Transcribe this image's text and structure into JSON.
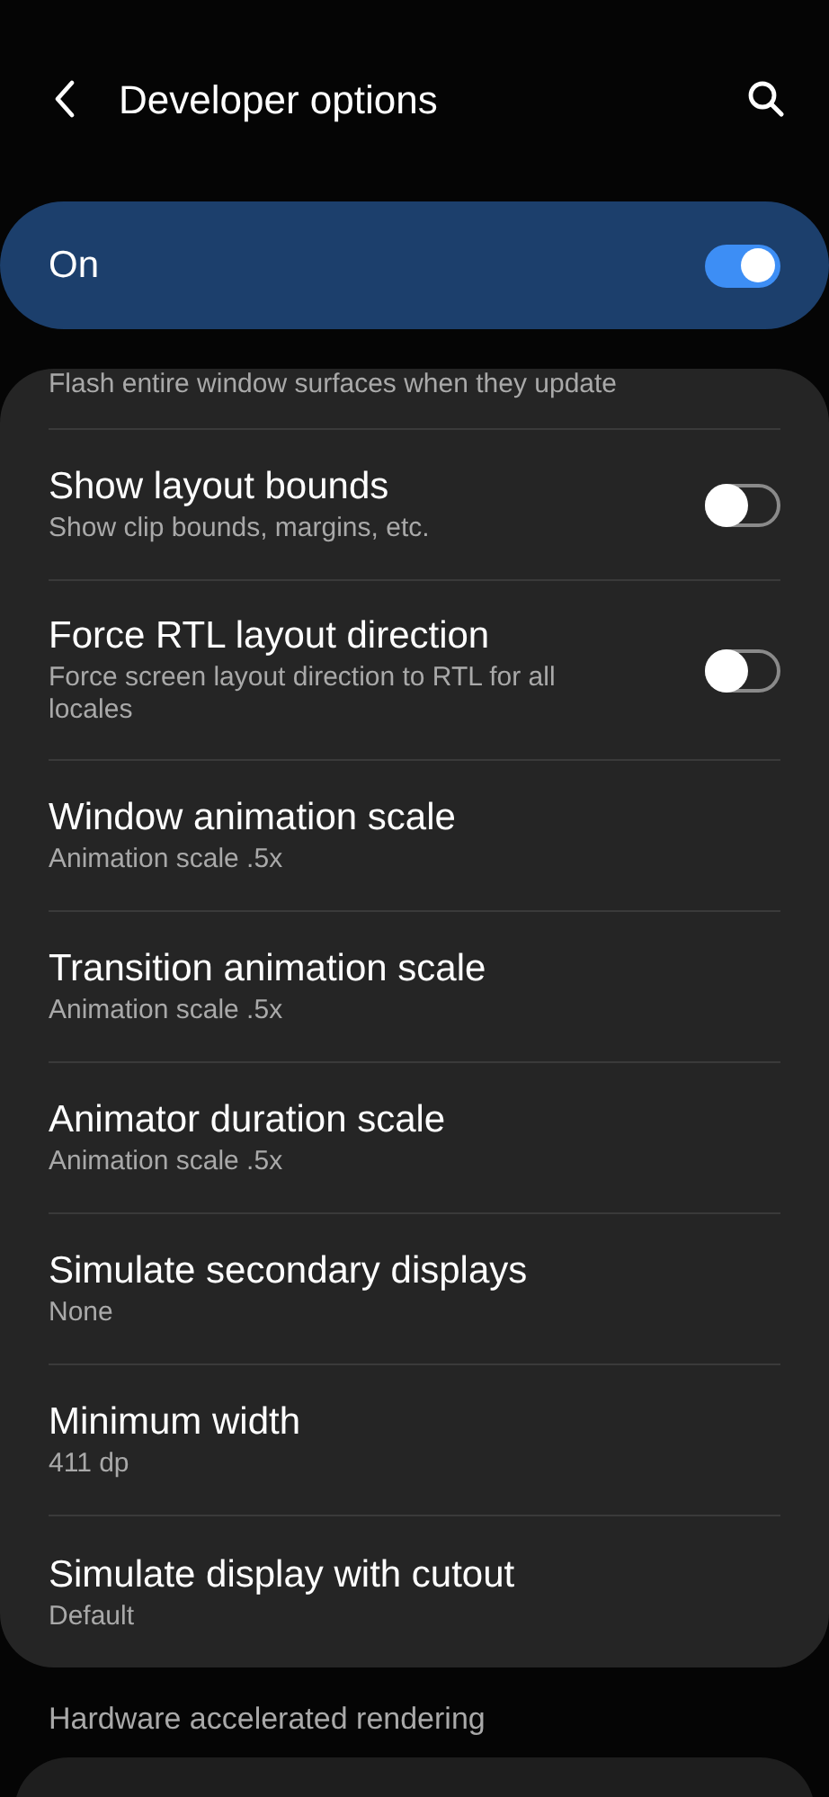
{
  "header": {
    "title": "Developer options"
  },
  "master_switch": {
    "label": "On",
    "on": true
  },
  "partial_row": {
    "summary": "Flash entire window surfaces when they update"
  },
  "rows": [
    {
      "kind": "switch",
      "title": "Show layout bounds",
      "summary": "Show clip bounds, margins, etc.",
      "checked": false
    },
    {
      "kind": "switch",
      "title": "Force RTL layout direction",
      "summary": "Force screen layout direction to RTL for all locales",
      "checked": false
    },
    {
      "kind": "value",
      "title": "Window animation scale",
      "summary": "Animation scale .5x"
    },
    {
      "kind": "value",
      "title": "Transition animation scale",
      "summary": "Animation scale .5x"
    },
    {
      "kind": "value",
      "title": "Animator duration scale",
      "summary": "Animation scale .5x"
    },
    {
      "kind": "value",
      "title": "Simulate secondary displays",
      "summary": "None"
    },
    {
      "kind": "value",
      "title": "Minimum width",
      "summary": "411 dp"
    },
    {
      "kind": "value",
      "title": "Simulate display with cutout",
      "summary": "Default"
    }
  ],
  "section_header": "Hardware accelerated rendering"
}
